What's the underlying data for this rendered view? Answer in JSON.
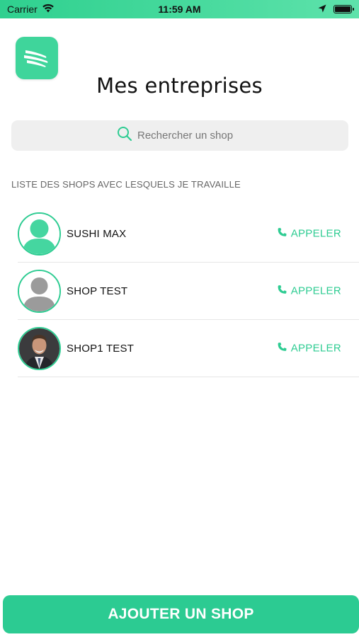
{
  "status_bar": {
    "carrier": "Carrier",
    "time": "11:59 AM"
  },
  "header": {
    "title": "Mes entreprises"
  },
  "search": {
    "placeholder": "Rechercher un shop",
    "value": ""
  },
  "list": {
    "section_label": "LISTE DES SHOPS AVEC LESQUELS JE TRAVAILLE",
    "shops": [
      {
        "name": "SUSHI MAX",
        "call_label": "APPELER",
        "avatar": "default-green-avatar"
      },
      {
        "name": "SHOP TEST",
        "call_label": "APPELER",
        "avatar": "default-gray-avatar"
      },
      {
        "name": "SHOP1 TEST",
        "call_label": "APPELER",
        "avatar": "photo-avatar"
      }
    ]
  },
  "footer": {
    "add_label": "AJOUTER UN SHOP"
  },
  "colors": {
    "accent": "#2ecc92",
    "status_bar": "#45d99c",
    "search_bg": "#efefef"
  }
}
